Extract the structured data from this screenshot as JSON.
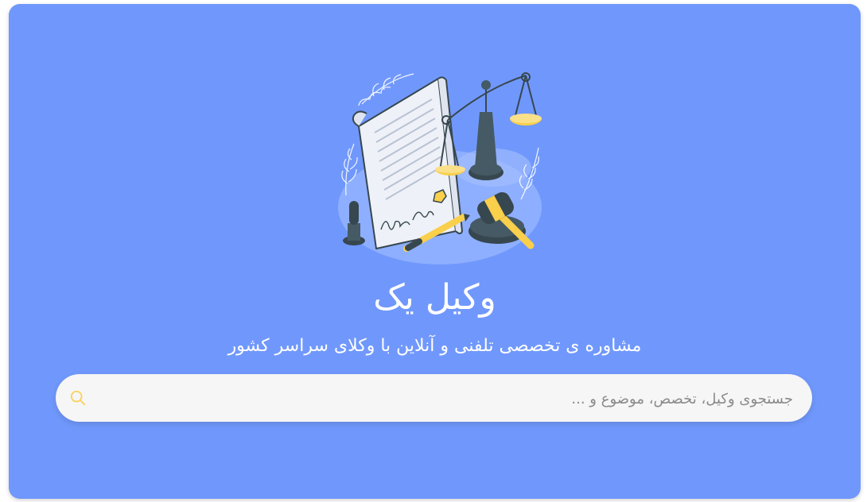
{
  "hero": {
    "title": "وکیل یک",
    "subtitle": "مشاوره ی تخصصی تلفنی و آنلاین با وکلای سراسر کشور"
  },
  "search": {
    "placeholder": "جستجوی وکیل، تخصص، موضوع و ...",
    "value": "",
    "icon": "search-icon"
  },
  "illustration": {
    "icon": "legal-scales-illustration"
  },
  "colors": {
    "background": "#7098fc",
    "search_bg": "#f6f6f6",
    "accent": "#f9cf4b",
    "text": "#ffffff"
  }
}
